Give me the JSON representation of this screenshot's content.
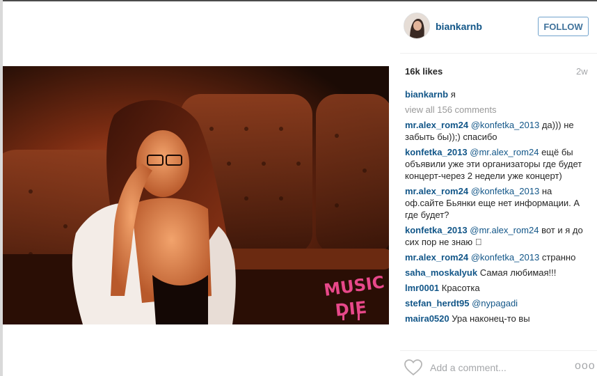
{
  "post": {
    "username": "biankarnb",
    "follow_label": "FOLLOW",
    "likes": "16k likes",
    "time": "2w",
    "caption": {
      "user": "biankarnb",
      "text": "я"
    },
    "view_all": "view all 156 comments",
    "comments": [
      {
        "user": "mr.alex_rom24",
        "mention": "@konfetka_2013",
        "text": "да))) не забыть бы));) спасибо"
      },
      {
        "user": "konfetka_2013",
        "mention": "@mr.alex_rom24",
        "text": "ещё бы объявили уже эти организаторы где будет концерт-через 2 недели уже концерт)"
      },
      {
        "user": "mr.alex_rom24",
        "mention": "@konfetka_2013",
        "text": "на оф.сайте Бьянки еще нет информации. А где будет?"
      },
      {
        "user": "konfetka_2013",
        "mention": "@mr.alex_rom24",
        "text": "вот и я до сих пор не знаю 󾌴"
      },
      {
        "user": "mr.alex_rom24",
        "mention": "@konfetka_2013",
        "text": "странно"
      },
      {
        "user": "saha_moskalyuk",
        "mention": "",
        "text": "Самая любимая!!!"
      },
      {
        "user": "lmr0001",
        "mention": "",
        "text": "Красотка"
      },
      {
        "user": "stefan_herdt95",
        "mention": "@nypagadi",
        "text": ""
      },
      {
        "user": "maira0520",
        "mention": "",
        "text": "Ура наконец-то вы"
      }
    ],
    "add_comment_placeholder": "Add a comment...",
    "more_label": "ooo",
    "watermark": "MUSIC DIE",
    "icons": {
      "like": "heart-icon",
      "options": "more-options-icon"
    },
    "colors": {
      "link": "#125688",
      "follow": "#3f729b",
      "muted": "#a5a7aa"
    }
  }
}
